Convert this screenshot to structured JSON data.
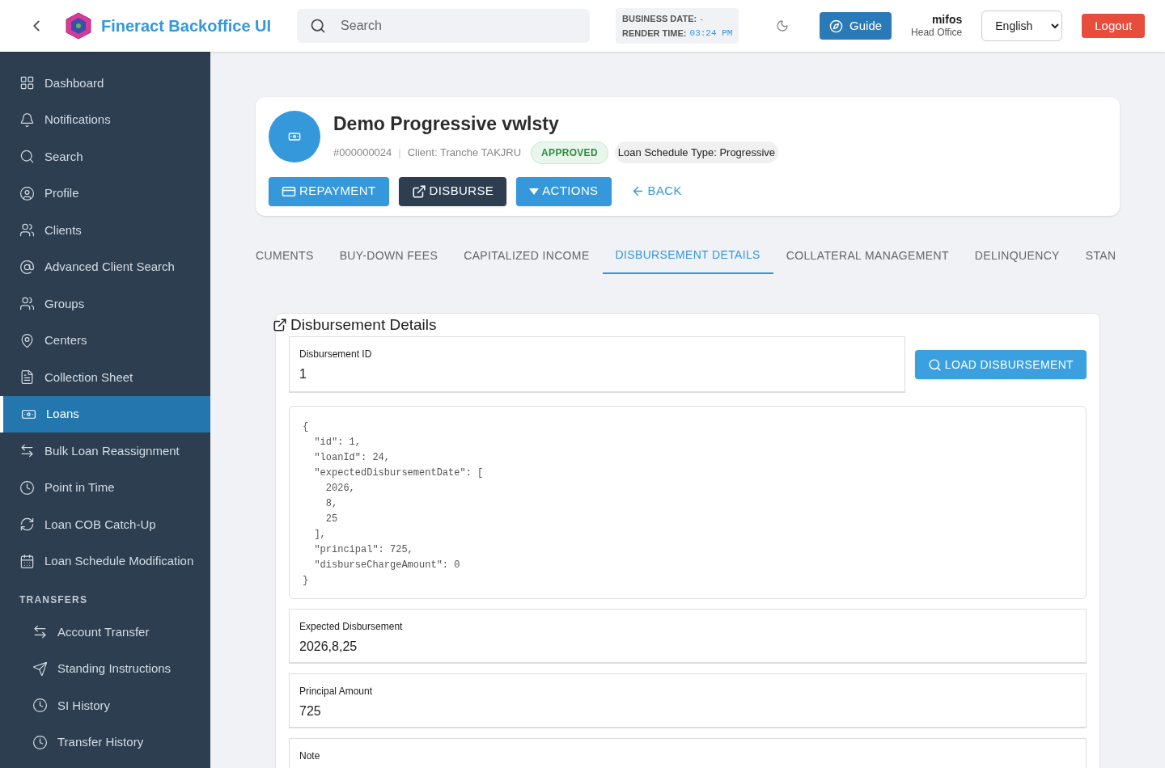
{
  "header": {
    "app_title": "Fineract Backoffice UI",
    "search": {
      "placeholder": "Search"
    },
    "business_date_label": "BUSINESS DATE:",
    "business_date": "-",
    "render_time_label": "RENDER TIME:",
    "render_time": "03:24 PM",
    "guide": "Guide",
    "user": {
      "name": "mifos",
      "office": "Head Office"
    },
    "language": "English",
    "logout": "Logout"
  },
  "sidebar": {
    "items": [
      {
        "label": "Dashboard",
        "kind": "grid",
        "selected": false
      },
      {
        "label": "Notifications",
        "kind": "bell",
        "selected": false
      },
      {
        "label": "Search",
        "kind": "search",
        "selected": false
      },
      {
        "label": "Profile",
        "kind": "user",
        "selected": false
      },
      {
        "label": "Clients",
        "kind": "users",
        "selected": false
      },
      {
        "label": "Advanced Client Search",
        "kind": "at",
        "selected": false
      },
      {
        "label": "Groups",
        "kind": "users",
        "selected": false
      },
      {
        "label": "Centers",
        "kind": "pin",
        "selected": false
      },
      {
        "label": "Collection Sheet",
        "kind": "sheet",
        "selected": false
      },
      {
        "label": "Loans",
        "kind": "money",
        "selected": true
      },
      {
        "label": "Bulk Loan Reassignment",
        "kind": "swap",
        "selected": false
      },
      {
        "label": "Point in Time",
        "kind": "clock",
        "selected": false
      },
      {
        "label": "Loan COB Catch-Up",
        "kind": "refresh",
        "selected": false
      },
      {
        "label": "Loan Schedule Modification",
        "kind": "calendar",
        "selected": false
      }
    ],
    "section": {
      "title": "TRANSFERS",
      "items": [
        {
          "label": "Account Transfer",
          "kind": "swap",
          "selected": false
        },
        {
          "label": "Standing Instructions",
          "kind": "send",
          "selected": false
        },
        {
          "label": "SI History",
          "kind": "clock",
          "selected": false
        },
        {
          "label": "Transfer History",
          "kind": "clock",
          "selected": false
        }
      ]
    }
  },
  "loan": {
    "name": "Demo Progressive vwlsty",
    "number": "#000000024",
    "separator": "|",
    "client": "Client: Tranche TAKJRU",
    "status": "APPROVED",
    "schedule_type": "Loan Schedule Type: Progressive",
    "buttons": [
      {
        "label": "REPAYMENT",
        "kind": "repayment"
      },
      {
        "label": "DISBURSE",
        "kind": "disburse"
      },
      {
        "label": "ACTIONS",
        "kind": "actions"
      },
      {
        "label": "BACK",
        "kind": "back"
      }
    ]
  },
  "tabs": [
    {
      "label": "CUMENTS",
      "selected": false
    },
    {
      "label": "BUY-DOWN FEES",
      "selected": false
    },
    {
      "label": "CAPITALIZED INCOME",
      "selected": false
    },
    {
      "label": "DISBURSEMENT DETAILS",
      "selected": true
    },
    {
      "label": "COLLATERAL MANAGEMENT",
      "selected": false
    },
    {
      "label": "DELINQUENCY",
      "selected": false
    },
    {
      "label": "STAN",
      "selected": false
    }
  ],
  "details": {
    "title": "Disbursement Details",
    "id_field": {
      "label": "Disbursement ID",
      "value": "1"
    },
    "load_button": "LOAD DISBURSEMENT",
    "json": "{\n  \"id\": 1,\n  \"loanId\": 24,\n  \"expectedDisbursementDate\": [\n    2026,\n    8,\n    25\n  ],\n  \"principal\": 725,\n  \"disburseChargeAmount\": 0\n}",
    "fields": [
      {
        "label": "Expected Disbursement",
        "value": "2026,8,25"
      },
      {
        "label": "Principal Amount",
        "value": "725"
      },
      {
        "label": "Note"
      }
    ]
  }
}
